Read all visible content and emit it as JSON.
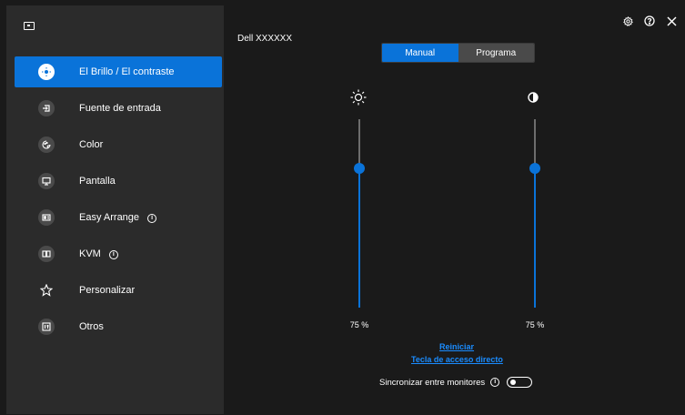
{
  "header": {
    "model": "Dell XXXXXX"
  },
  "sidebar": {
    "items": [
      {
        "label": "El Brillo / El contraste",
        "icon": "brightness-icon",
        "active": true
      },
      {
        "label": "Fuente de entrada",
        "icon": "input-source-icon"
      },
      {
        "label": "Color",
        "icon": "color-icon"
      },
      {
        "label": "Pantalla",
        "icon": "display-icon"
      },
      {
        "label": "Easy Arrange",
        "icon": "easy-arrange-icon",
        "info": true
      },
      {
        "label": "KVM",
        "icon": "kvm-icon",
        "info": true
      },
      {
        "label": "Personalizar",
        "icon": "star-icon"
      },
      {
        "label": "Otros",
        "icon": "others-icon"
      }
    ],
    "info_symbol": "i"
  },
  "mode_tabs": {
    "manual": "Manual",
    "programa": "Programa",
    "selected": "Manual"
  },
  "sliders": {
    "brightness": {
      "value_label": "75 %",
      "value": 75,
      "icon": "sun-icon"
    },
    "contrast": {
      "value_label": "75 %",
      "value": 75,
      "icon": "contrast-icon"
    }
  },
  "links": {
    "reset": "Reiniciar",
    "hotkey": "Tecla de acceso directo"
  },
  "sync": {
    "label": "Sincronizar entre monitores",
    "enabled": false
  },
  "colors": {
    "accent": "#0a73d9",
    "link": "#1a8cff",
    "sidebar_bg": "#2b2b2b",
    "main_bg": "#1a1a1a"
  }
}
